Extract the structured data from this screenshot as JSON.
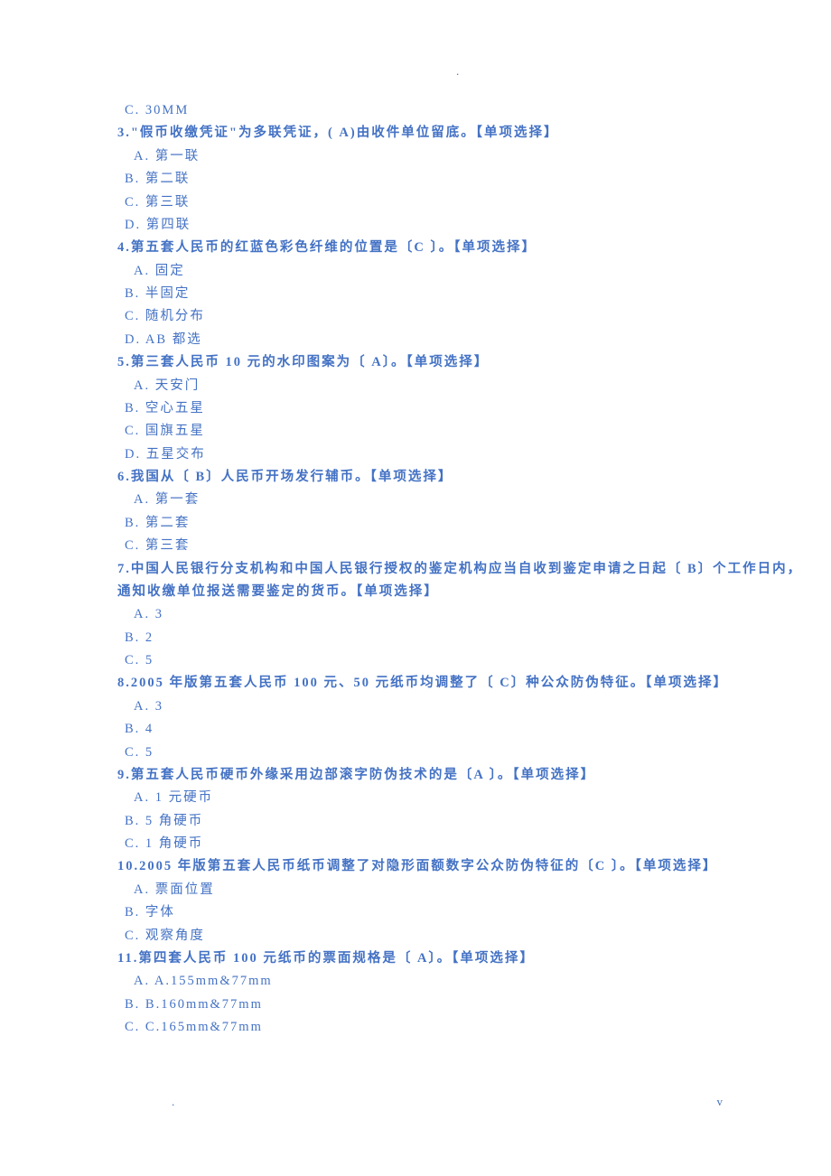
{
  "topDot": ".",
  "footerDot": ".",
  "footerV": "v",
  "orphanOption": "C. 30MM",
  "questions": [
    {
      "num": "3.",
      "stem": "\"假币收缴凭证\"为多联凭证，( A)由收件单位留底。【单项选择】",
      "options": [
        "A. 第一联",
        "B. 第二联",
        "C. 第三联",
        "D. 第四联"
      ]
    },
    {
      "num": "4.",
      "stem": "第五套人民币的红蓝色彩色纤维的位置是〔C 〕。【单项选择】",
      "options": [
        "A. 固定",
        "B. 半固定",
        "C. 随机分布",
        "D. AB 都选"
      ]
    },
    {
      "num": "5.",
      "stem": "第三套人民币 10 元的水印图案为〔 A〕。【单项选择】",
      "options": [
        "A. 天安门",
        "B. 空心五星",
        "C. 国旗五星",
        "D. 五星交布"
      ]
    },
    {
      "num": "6.",
      "stem": "我国从〔 B〕人民币开场发行辅币。【单项选择】",
      "options": [
        "A. 第一套",
        "B. 第二套",
        "C. 第三套"
      ]
    },
    {
      "num": "7.",
      "stem": "中国人民银行分支机构和中国人民银行授权的鉴定机构应当自收到鉴定申请之日起〔 B〕个工作日内，",
      "stem2": "通知收缴单位报送需要鉴定的货币。【单项选择】",
      "options": [
        "A. 3",
        "B. 2",
        "C. 5"
      ]
    },
    {
      "num": "8.",
      "stem": "2005 年版第五套人民币 100 元、50 元纸币均调整了〔 C〕种公众防伪特征。【单项选择】",
      "options": [
        "A. 3",
        "B. 4",
        "C. 5"
      ]
    },
    {
      "num": "9.",
      "stem": "第五套人民币硬币外缘采用边部滚字防伪技术的是〔A 〕。【单项选择】",
      "options": [
        "A. 1 元硬币",
        "B. 5 角硬币",
        "C. 1 角硬币"
      ]
    },
    {
      "num": "10.",
      "stem": "2005 年版第五套人民币纸币调整了对隐形面额数字公众防伪特征的〔C 〕。【单项选择】",
      "options": [
        "A. 票面位置",
        "B. 字体",
        "C. 观察角度"
      ]
    },
    {
      "num": "11.",
      "stem": "第四套人民币 100 元纸币的票面规格是〔 A〕。【单项选择】",
      "options": [
        "A. A.155mm&77mm",
        "B. B.160mm&77mm",
        "C. C.165mm&77mm"
      ]
    }
  ]
}
